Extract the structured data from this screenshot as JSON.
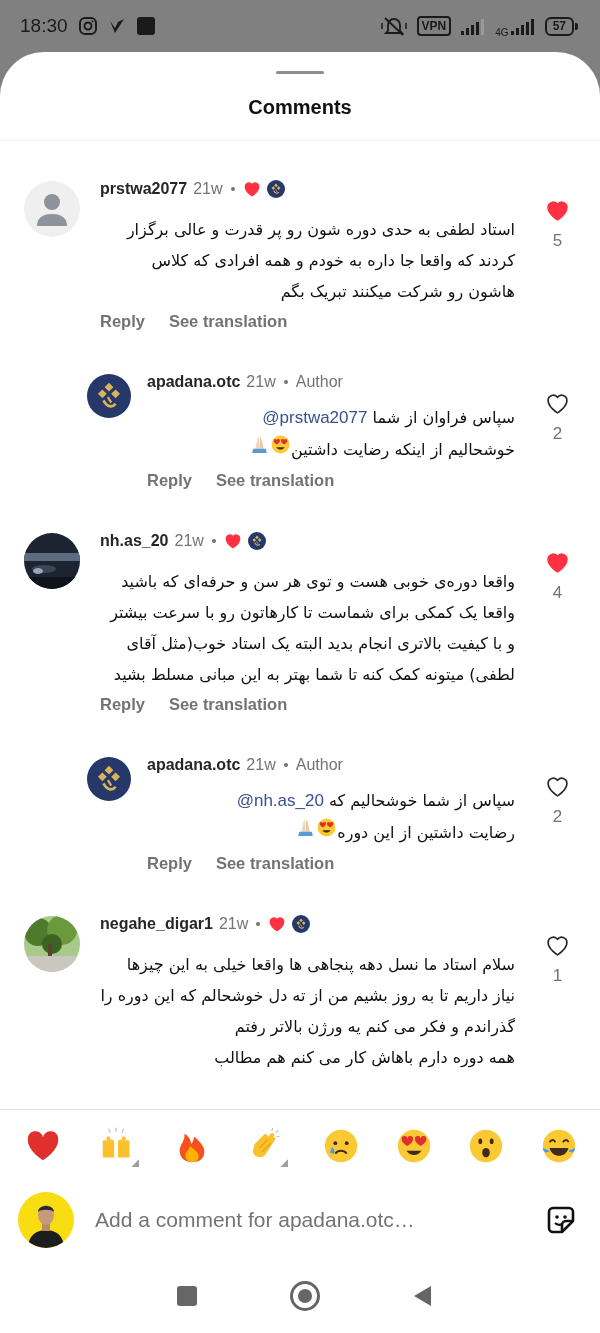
{
  "status_bar": {
    "time": "18:30",
    "vpn": "VPN",
    "network": "4G",
    "battery": "57"
  },
  "sheet": {
    "title": "Comments"
  },
  "comments": [
    {
      "username": "prstwa2077",
      "avatar": {
        "kind": "default"
      },
      "time": "21w",
      "liked_by_author": true,
      "text": "استاد لطفی به حدی دوره شون رو پر قدرت و عالی برگزار کردند که واقعا جا داره به خودم و همه افرادی که کلاس هاشون رو شرکت میکنند تبریک بگم",
      "liked": true,
      "likes": "5",
      "actions": {
        "reply": "Reply",
        "translate": "See translation"
      },
      "replies": [
        {
          "username": "apadana.otc",
          "avatar": {
            "kind": "brand"
          },
          "time": "21w",
          "badge": "Author",
          "text": "سپاس فراوان از شما",
          "mention": "@prstwa2077",
          "text_2": "خوشحالیم از اینکه رضایت داشتین",
          "emojis": [
            {
              "kind": "heart_eyes"
            },
            {
              "kind": "folded_hands"
            }
          ],
          "liked": false,
          "likes": "2",
          "actions": {
            "reply": "Reply",
            "translate": "See translation"
          }
        }
      ]
    },
    {
      "username": "nh.as_20",
      "avatar": {
        "kind": "picture"
      },
      "time": "21w",
      "liked_by_author": true,
      "text": "واقعا دوره‌ی خوبی هست و توی هر سن و حرفه‌ای که باشید واقعا یک کمکی برای شماست تا کارهاتون رو با سرعت بیشتر و با کیفیت بالاتری انجام بدید البته یک استاد خوب(مثل آقای لطفی) میتونه کمک کنه تا شما بهتر به این مبانی مسلط بشید",
      "liked": true,
      "likes": "4",
      "actions": {
        "reply": "Reply",
        "translate": "See translation"
      },
      "replies": [
        {
          "username": "apadana.otc",
          "avatar": {
            "kind": "brand"
          },
          "time": "21w",
          "badge": "Author",
          "text": "سپاس از شما خوشحالیم که",
          "mention": "@nh.as_20",
          "text_2": "رضایت داشتین از این دوره",
          "emojis": [
            {
              "kind": "heart_eyes"
            },
            {
              "kind": "folded_hands"
            }
          ],
          "liked": false,
          "likes": "2",
          "actions": {
            "reply": "Reply",
            "translate": "See translation"
          }
        }
      ]
    },
    {
      "username": "negahe_digar1",
      "avatar": {
        "kind": "picture"
      },
      "time": "21w",
      "liked_by_author": true,
      "text": "سلام استاد ما نسل دهه پنجاهی ها واقعا خیلی به این چیزها نیاز داریم تا به روز بشیم من از ته دل خوشحالم که این دوره را گذراندم و فکر می کنم یه ورژن بالاتر رفتم",
      "text_more": "همه دوره دارم باهاش کار می کنم هم مطالب",
      "liked": false,
      "likes": "1"
    }
  ],
  "reactions": [
    {
      "kind": "heart",
      "skin_tones": false
    },
    {
      "kind": "raised_hands",
      "skin_tones": true
    },
    {
      "kind": "fire",
      "skin_tones": false
    },
    {
      "kind": "clap",
      "skin_tones": true
    },
    {
      "kind": "crying",
      "skin_tones": false
    },
    {
      "kind": "heart_eyes",
      "skin_tones": false
    },
    {
      "kind": "surprised",
      "skin_tones": false
    },
    {
      "kind": "tears_of_joy",
      "skin_tones": false
    }
  ],
  "composer": {
    "placeholder": "Add a comment for apadana.otc…"
  }
}
